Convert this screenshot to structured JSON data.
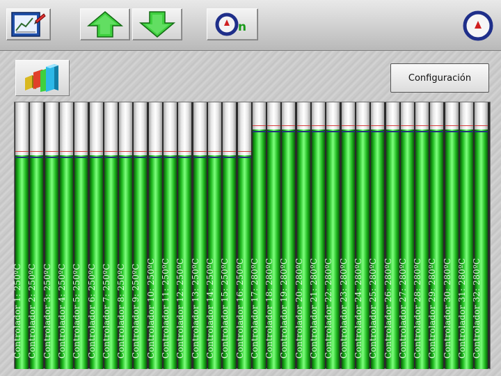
{
  "toolbar": {
    "buttons": [
      {
        "name": "chart-edit-button",
        "icon": "chart-edit-icon"
      },
      {
        "name": "arrow-up-button",
        "icon": "arrow-up-icon"
      },
      {
        "name": "arrow-down-button",
        "icon": "arrow-down-icon"
      },
      {
        "name": "power-on-button",
        "icon": "power-on-icon",
        "label": "n"
      },
      {
        "name": "status-gauge",
        "icon": "gauge-icon"
      }
    ]
  },
  "main": {
    "config_label": "Configuración",
    "graph_button_icon": "bar-graph-3d-icon"
  },
  "colors": {
    "fill_green": "#1fb81f",
    "background_bars": "#2b2b2b",
    "limit_red": "#d63a3a",
    "limit_blue": "#22337a"
  },
  "controllers": [
    {
      "label": "Controlador 1: 250ºC",
      "value": 250
    },
    {
      "label": "Controlador 2: 250ºC",
      "value": 250
    },
    {
      "label": "Controlador 3: 250ºC",
      "value": 250
    },
    {
      "label": "Controlador 4: 250ºC",
      "value": 250
    },
    {
      "label": "Controlador 5: 250ºC",
      "value": 250
    },
    {
      "label": "Controlador 6: 250ºC",
      "value": 250
    },
    {
      "label": "Controlador 7: 250ºC",
      "value": 250
    },
    {
      "label": "Controlador 8: 250ºC",
      "value": 250
    },
    {
      "label": "Controlador 9: 250ºC",
      "value": 250
    },
    {
      "label": "Controlador 10: 250ºC",
      "value": 250
    },
    {
      "label": "Controlador 11: 250ºC",
      "value": 250
    },
    {
      "label": "Controlador 12: 250ºC",
      "value": 250
    },
    {
      "label": "Controlador 13: 250ºC",
      "value": 250
    },
    {
      "label": "Controlador 14: 250ºC",
      "value": 250
    },
    {
      "label": "Controlador 15: 250ºC",
      "value": 250
    },
    {
      "label": "Controlador 16: 250ºC",
      "value": 250
    },
    {
      "label": "Controlador 17: 280ºC",
      "value": 280
    },
    {
      "label": "Controlador 18: 280ºC",
      "value": 280
    },
    {
      "label": "Controlador 19: 280ºC",
      "value": 280
    },
    {
      "label": "Controlador 20: 280ºC",
      "value": 280
    },
    {
      "label": "Controlador 21: 280ºC",
      "value": 280
    },
    {
      "label": "Controlador 22: 280ºC",
      "value": 280
    },
    {
      "label": "Controlador 23: 280ºC",
      "value": 280
    },
    {
      "label": "Controlador 24: 280ºC",
      "value": 280
    },
    {
      "label": "Controlador 25: 280ºC",
      "value": 280
    },
    {
      "label": "Controlador 26: 280ºC",
      "value": 280
    },
    {
      "label": "Controlador 27: 280ºC",
      "value": 280
    },
    {
      "label": "Controlador 28: 280ºC",
      "value": 280
    },
    {
      "label": "Controlador 29: 280ºC",
      "value": 280
    },
    {
      "label": "Controlador 30: 280ºC",
      "value": 280
    },
    {
      "label": "Controlador 31: 280ºC",
      "value": 280
    },
    {
      "label": "Controlador 32: 280ºC",
      "value": 280
    }
  ]
}
